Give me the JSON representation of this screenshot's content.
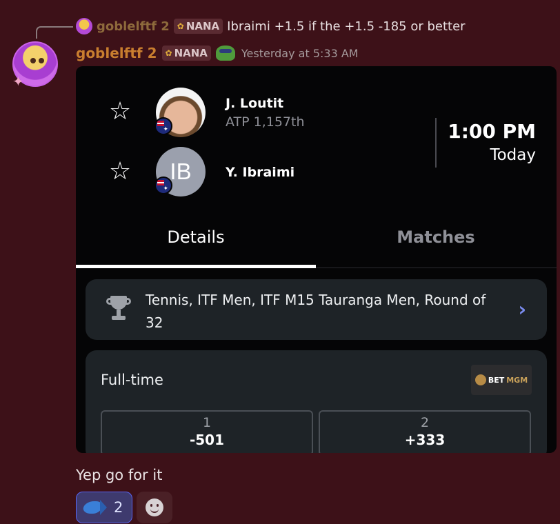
{
  "reply": {
    "author": "goblelftf 2",
    "tag": "NANA",
    "text": "Ibraimi +1.5 if the +1.5 -185 or better",
    "avatar_icon": "avatar-icon"
  },
  "message": {
    "author": "goblelftf 2",
    "tag": "NANA",
    "timestamp": "Yesterday at 5:33 AM",
    "author_color": "#c97e2f"
  },
  "match_card": {
    "players": [
      {
        "name": "J. Loutit",
        "rank": "ATP 1,157th",
        "flag": "australia-flag",
        "initials": ""
      },
      {
        "name": "Y. Ibraimi",
        "rank": "",
        "flag": "australia-flag",
        "initials": "IB"
      }
    ],
    "time": "1:00 PM",
    "day": "Today",
    "tabs": [
      {
        "label": "Details",
        "active": true
      },
      {
        "label": "Matches",
        "active": false
      }
    ],
    "tournament": "Tennis, ITF Men, ITF M15 Tauranga Men, Round of 32",
    "odds": {
      "label": "Full-time",
      "bookmaker_prefix": "BET",
      "bookmaker_suffix": "MGM",
      "options": [
        {
          "selection": "1",
          "price": "-501"
        },
        {
          "selection": "2",
          "price": "+333"
        }
      ]
    }
  },
  "followup": {
    "text": "Yep go for it"
  },
  "reactions": [
    {
      "icon": "fish-emoji-icon",
      "count": "2",
      "active": true
    },
    {
      "icon": "add-reaction-icon"
    }
  ],
  "colors": {
    "background": "#3d1118",
    "card": "#050506",
    "panel": "#1e2327",
    "accent": "#5865f2"
  }
}
